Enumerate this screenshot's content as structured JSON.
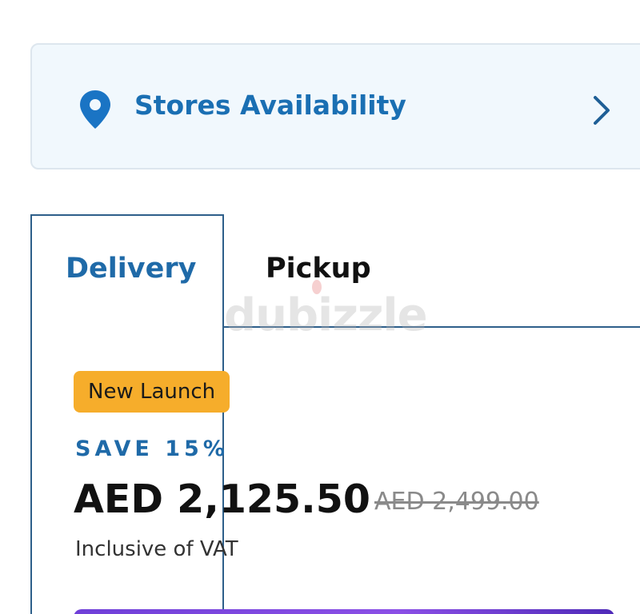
{
  "stores": {
    "label": "Stores Availability",
    "icon": "location-pin-icon",
    "chevron": "chevron-right-icon"
  },
  "tabs": [
    {
      "label": "Delivery",
      "active": true
    },
    {
      "label": "Pickup",
      "active": false
    }
  ],
  "watermark": "dubizzle",
  "offer": {
    "badge": "New Launch",
    "save": "SAVE 15%",
    "price": "AED 2,125.50",
    "old_price": "AED 2,499.00",
    "vat_note": "Inclusive of VAT"
  },
  "colors": {
    "accent_blue": "#1f6aa8",
    "badge_orange": "#f6ad2b",
    "cta_purple": "#6f3fd8"
  }
}
